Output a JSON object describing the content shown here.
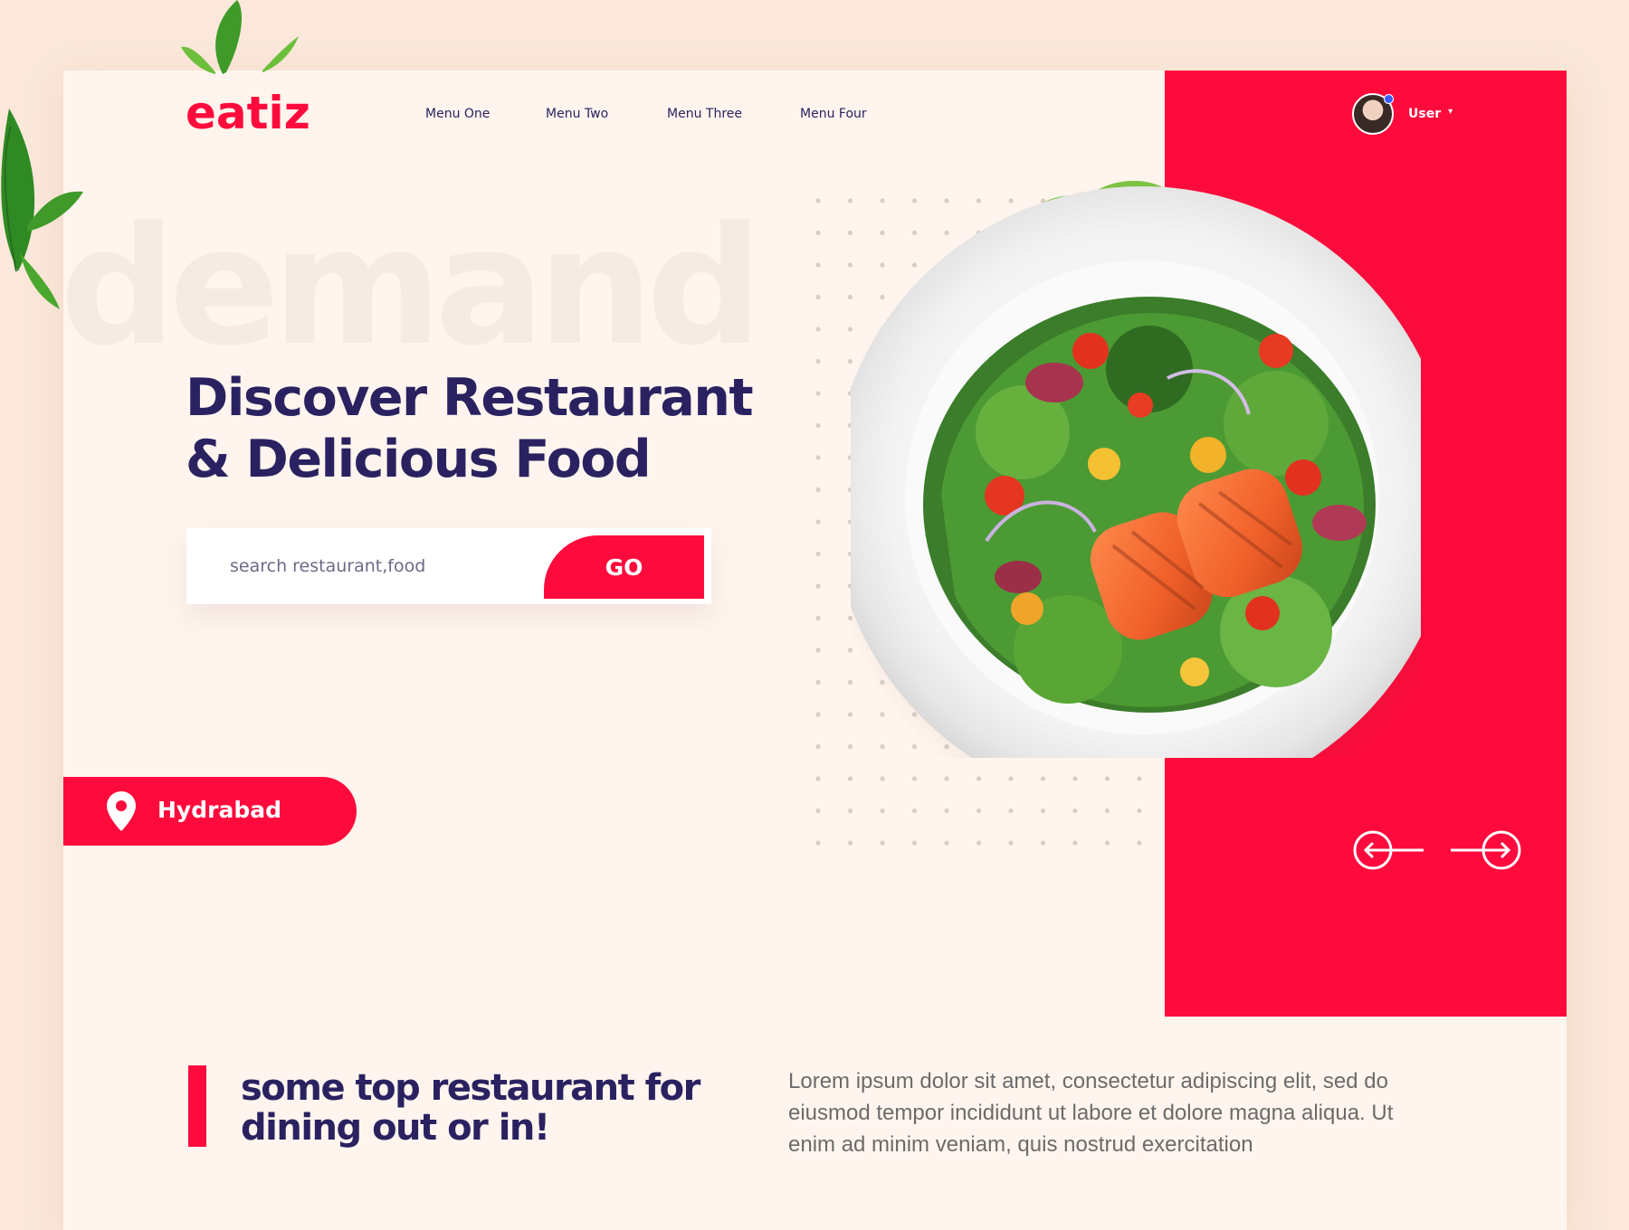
{
  "brand": {
    "logo_text": "eatiz",
    "accent_color": "#ff0a3c",
    "navy_color": "#2a2260"
  },
  "nav": {
    "items": [
      "Menu One",
      "Menu Two",
      "Menu Three",
      "Menu Four"
    ]
  },
  "user": {
    "label": "User",
    "avatar_icon": "avatar-photo",
    "caret_icon": "caret-down-icon"
  },
  "hero": {
    "background_word": "demand",
    "title_lines": [
      "Discover Restaurant",
      "& Delicious Food"
    ],
    "image": "salmon-salad-plate"
  },
  "search": {
    "placeholder": "search restaurant,food",
    "button_label": "GO"
  },
  "location": {
    "label": "Hydrabad",
    "icon": "map-pin-icon"
  },
  "carousel": {
    "prev_icon": "arrow-left-circle-icon",
    "next_icon": "arrow-right-circle-icon"
  },
  "section": {
    "title_lines": [
      "some top restaurant for",
      "dining out or in!"
    ],
    "body": "Lorem ipsum dolor sit amet, consectetur adipiscing elit, sed do eiusmod tempor incididunt ut labore et dolore magna aliqua. Ut enim ad minim veniam, quis nostrud exercitation"
  }
}
